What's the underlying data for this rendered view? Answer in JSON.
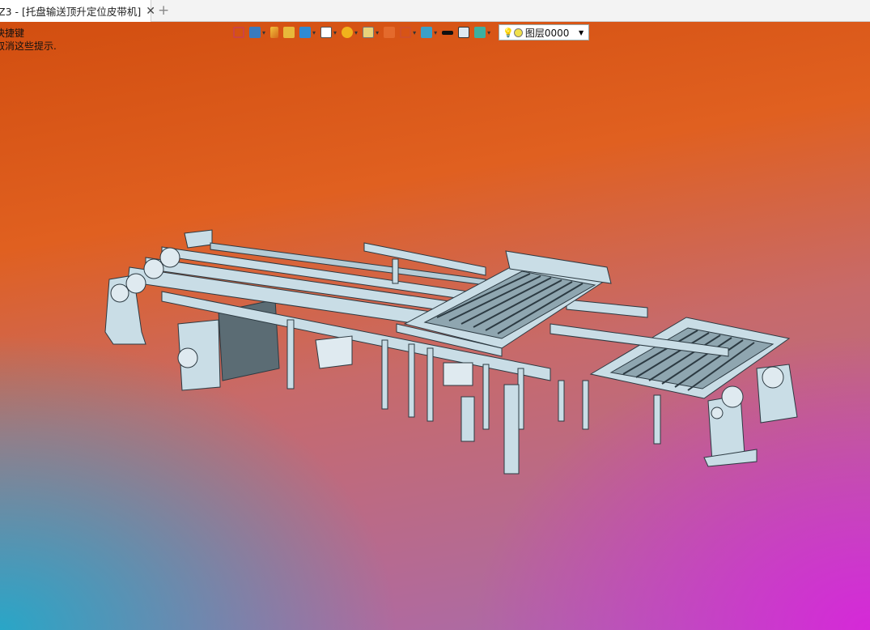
{
  "tab": {
    "title": "Z3 - [托盘输送顶升定位皮带机]",
    "close": "✕",
    "add": "+"
  },
  "hints": {
    "line1": "快捷键",
    "line2": "取消这些提示."
  },
  "toolbar": {
    "icons": [
      "exit-icon",
      "view-icon",
      "pencil-icon",
      "solid-icon",
      "box-icon",
      "cube-icon",
      "pie-icon",
      "zoom-icon",
      "frame-icon",
      "section-icon",
      "display-icon",
      "line-icon",
      "square-icon",
      "layer-stack-icon"
    ],
    "layer": {
      "label": "图层0000",
      "bulb": "💡"
    }
  },
  "colors": {
    "accent": "#0078d7",
    "part": "#c9dde6",
    "edge": "#2c3a42"
  }
}
